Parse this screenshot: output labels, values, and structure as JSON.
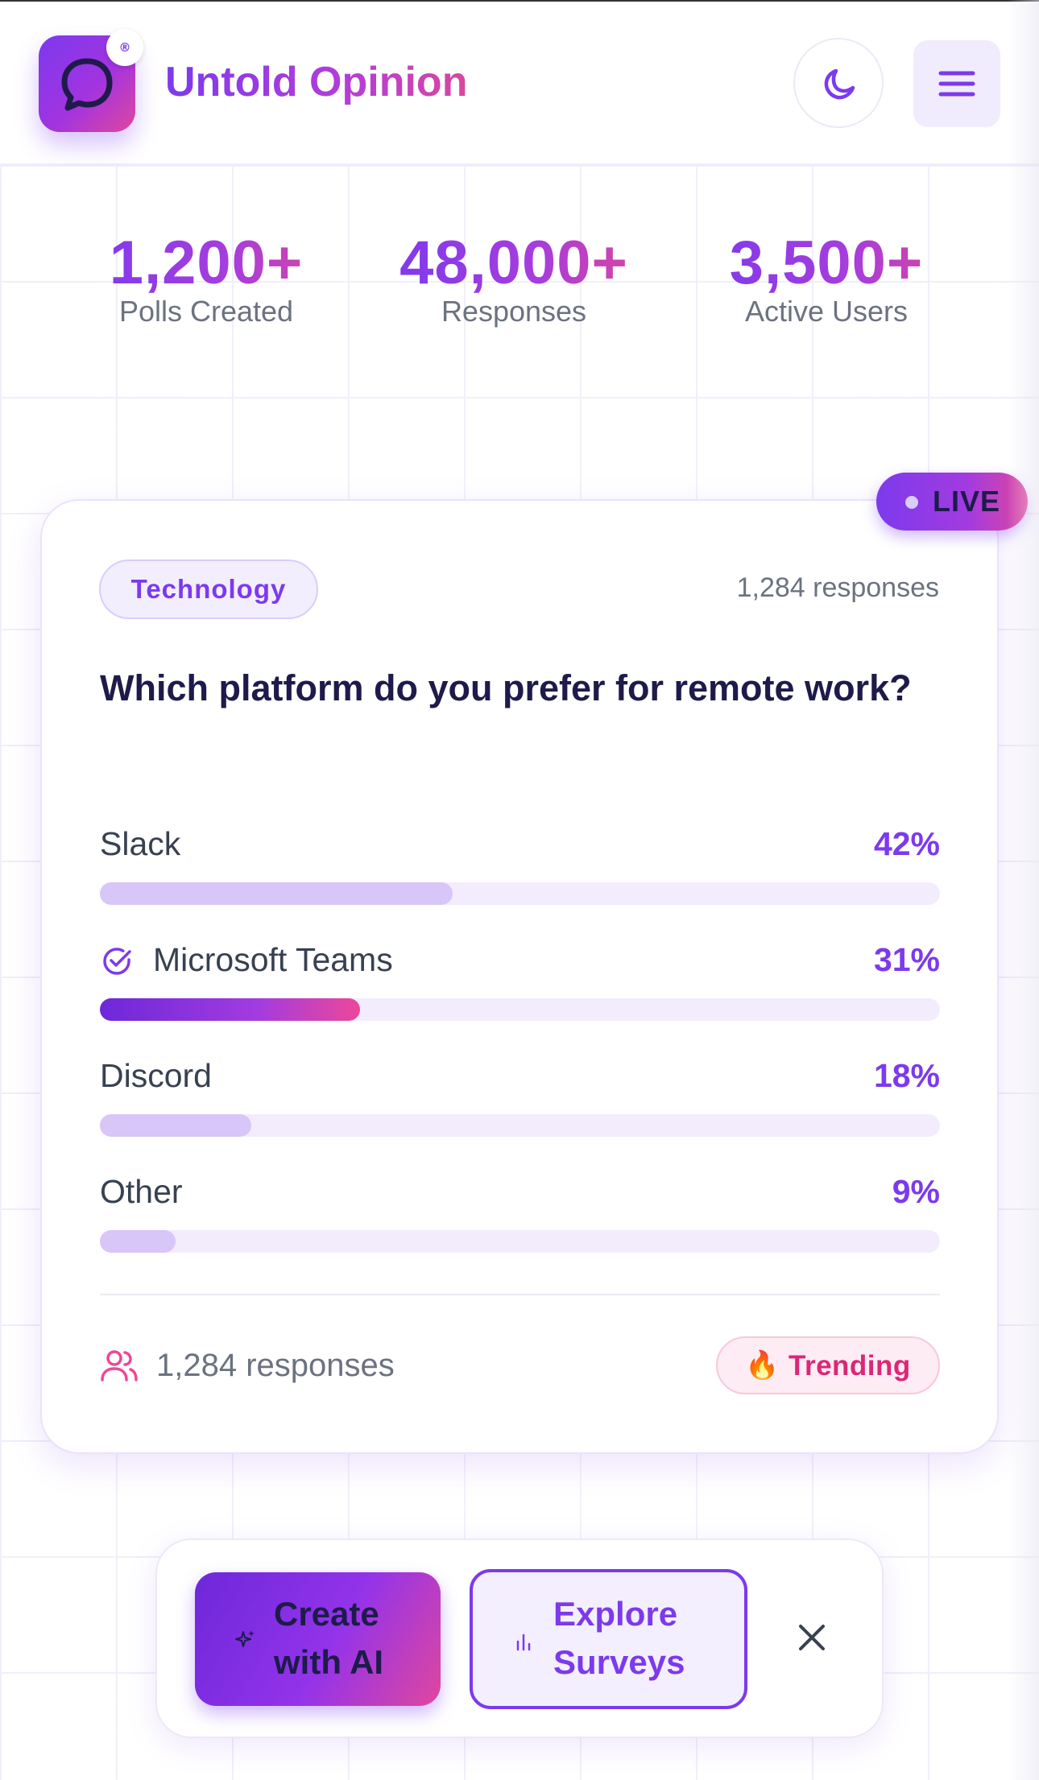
{
  "header": {
    "brand": "Untold Opinion",
    "logo_badge": "®",
    "icons": {
      "logo": "chat-bubble-icon",
      "theme": "moon-icon",
      "menu": "hamburger-menu-icon"
    }
  },
  "stats": [
    {
      "value": "1,200+",
      "label": "Polls Created"
    },
    {
      "value": "48,000+",
      "label": "Responses"
    },
    {
      "value": "3,500+",
      "label": "Active Users"
    }
  ],
  "poll": {
    "live_label": "LIVE",
    "category": "Technology",
    "responses_top": "1,284 responses",
    "question": "Which platform do you prefer for remote work?",
    "options": [
      {
        "label": "Slack",
        "pct_text": "42%",
        "value": 42,
        "selected": false
      },
      {
        "label": "Microsoft Teams",
        "pct_text": "31%",
        "value": 31,
        "selected": true
      },
      {
        "label": "Discord",
        "pct_text": "18%",
        "value": 18,
        "selected": false
      },
      {
        "label": "Other",
        "pct_text": "9%",
        "value": 9,
        "selected": false
      }
    ],
    "footer_responses": "1,284 responses",
    "trending_label": "Trending",
    "trending_icon": "🔥"
  },
  "actions": {
    "create_label": "Create with AI",
    "explore_label": "Explore Surveys",
    "icons": {
      "create": "sparkles-icon",
      "explore": "bar-chart-icon",
      "close": "close-icon"
    }
  },
  "colors": {
    "accent": "#7c3aed",
    "accent_pink": "#db2777",
    "bar_track": "#f3ecfd",
    "bar_fill": "#d7c6f7"
  }
}
